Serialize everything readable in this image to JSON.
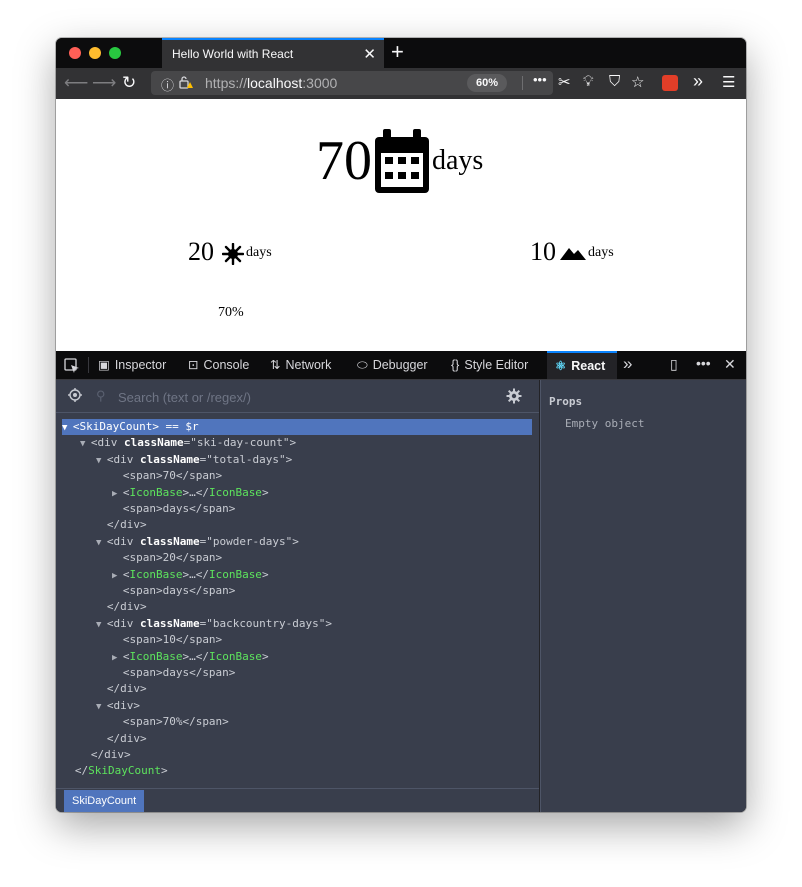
{
  "browser": {
    "tab_title": "Hello World with React",
    "tab_close": "✕",
    "new_tab": "+",
    "url_protocol": "https://",
    "url_host": "localhost",
    "url_port": ":3000",
    "zoom": "60%",
    "more_actions": "•••",
    "overflow": "»",
    "menu": "☰"
  },
  "app": {
    "total_days": "70",
    "total_label": "days",
    "powder_days": "20",
    "powder_label": "days",
    "backcountry_days": "10",
    "backcountry_label": "days",
    "goal_percent": "70%"
  },
  "devtools": {
    "tabs": {
      "inspector": "Inspector",
      "console": "Console",
      "network": "Network",
      "debugger": "Debugger",
      "style_editor": "Style Editor",
      "react": "React"
    },
    "search_placeholder": "Search (text or /regex/)",
    "selected_component": "SkiDayCount",
    "selected_ref": "== $r",
    "breadcrumb": "SkiDayCount",
    "props_title": "Props",
    "props_empty": "Empty object",
    "tree": [
      {
        "indent": 0,
        "arrow": "▼",
        "kind": "comp-open",
        "name": "SkiDayCount",
        "extra": " == $r"
      },
      {
        "indent": 1,
        "arrow": "▼",
        "kind": "div-class",
        "name": "div",
        "attr": "className",
        "value": "\"ski-day-count\""
      },
      {
        "indent": 2,
        "arrow": "▼",
        "kind": "div-class",
        "name": "div",
        "attr": "className",
        "value": "\"total-days\""
      },
      {
        "indent": 3,
        "arrow": "",
        "kind": "text",
        "text": "<span>70</span>"
      },
      {
        "indent": 3,
        "arrow": "▶",
        "kind": "comp-collapsed",
        "name": "IconBase"
      },
      {
        "indent": 3,
        "arrow": "",
        "kind": "text",
        "text": "<span>days</span>"
      },
      {
        "indent": 2,
        "arrow": "",
        "kind": "text",
        "text": "</div>"
      },
      {
        "indent": 2,
        "arrow": "▼",
        "kind": "div-class",
        "name": "div",
        "attr": "className",
        "value": "\"powder-days\""
      },
      {
        "indent": 3,
        "arrow": "",
        "kind": "text",
        "text": "<span>20</span>"
      },
      {
        "indent": 3,
        "arrow": "▶",
        "kind": "comp-collapsed",
        "name": "IconBase"
      },
      {
        "indent": 3,
        "arrow": "",
        "kind": "text",
        "text": "<span>days</span>"
      },
      {
        "indent": 2,
        "arrow": "",
        "kind": "text",
        "text": "</div>"
      },
      {
        "indent": 2,
        "arrow": "▼",
        "kind": "div-class",
        "name": "div",
        "attr": "className",
        "value": "\"backcountry-days\""
      },
      {
        "indent": 3,
        "arrow": "",
        "kind": "text",
        "text": "<span>10</span>"
      },
      {
        "indent": 3,
        "arrow": "▶",
        "kind": "comp-collapsed",
        "name": "IconBase"
      },
      {
        "indent": 3,
        "arrow": "",
        "kind": "text",
        "text": "<span>days</span>"
      },
      {
        "indent": 2,
        "arrow": "",
        "kind": "text",
        "text": "</div>"
      },
      {
        "indent": 2,
        "arrow": "▼",
        "kind": "text",
        "text": "<div>"
      },
      {
        "indent": 3,
        "arrow": "",
        "kind": "text",
        "text": "<span>70%</span>"
      },
      {
        "indent": 2,
        "arrow": "",
        "kind": "text",
        "text": "</div>"
      },
      {
        "indent": 1,
        "arrow": "",
        "kind": "text",
        "text": "</div>"
      },
      {
        "indent": 0,
        "arrow": "",
        "kind": "comp-close",
        "name": "SkiDayCount"
      }
    ]
  },
  "colors": {
    "accent": "#0a84ff",
    "selection": "#5075bd",
    "component_name": "#5de35d",
    "panel_bg": "#393e4c"
  }
}
